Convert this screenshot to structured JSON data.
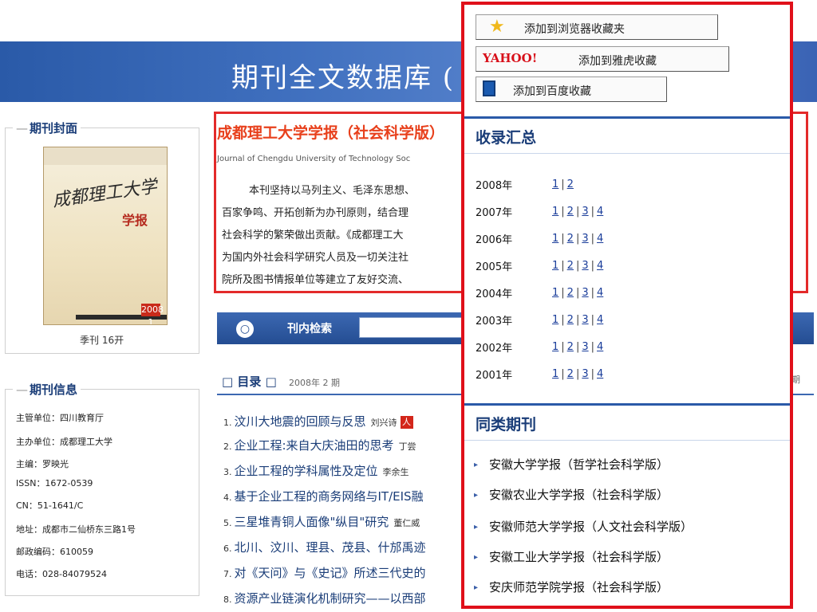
{
  "banner": {
    "title": "期刊全文数据库 ("
  },
  "left": {
    "cover_legend": "期刊封面",
    "cover_art": {
      "calligraphy": "成都理工大学",
      "xuebao": "学报",
      "badge": "2008 1"
    },
    "cover_caption": "季刊 16开",
    "info_legend": "期刊信息",
    "info": [
      "主管单位：四川教育厅",
      "主办单位：成都理工大学",
      "主编：罗映光",
      "ISSN：1672-0539",
      "CN：51-1641/C",
      "地址：成都市二仙桥东三路1号",
      "邮政编码：610059",
      "电话：028-84079524"
    ]
  },
  "journal": {
    "title": "成都理工大学学报（社会科学版）",
    "english": "Journal of Chengdu University of Technology Soc",
    "intro": [
      "本刊坚持以马列主义、毛泽东思想、",
      "百家争鸣、开拓创新为办刊原则，结合理",
      "社会科学的繁荣做出贡献。《成都理工大",
      "为国内外社会科学研究人员及一切关注社",
      "院所及图书情报单位等建立了友好交流、"
    ]
  },
  "search": {
    "label": "刊内检索",
    "icon": "magnifier-icon"
  },
  "toc": {
    "heading": "□ 目录 □",
    "issue": "2008年 2 期",
    "right_fragment": "期",
    "items": [
      {
        "num": "1.",
        "title": "汶川大地震的回顾与反思",
        "author": "刘兴诗",
        "pdf": "人"
      },
      {
        "num": "2.",
        "title": "企业工程:来自大庆油田的思考",
        "author": "丁尝",
        "pdf": ""
      },
      {
        "num": "3.",
        "title": "企业工程的学科属性及定位",
        "author": "李余生",
        "pdf": ""
      },
      {
        "num": "4.",
        "title": "基于企业工程的商务网络与IT/EIS融",
        "author": "",
        "pdf": ""
      },
      {
        "num": "5.",
        "title": "三星堆青铜人面像\"纵目\"研究",
        "author": "董仁威",
        "pdf": ""
      },
      {
        "num": "6.",
        "title": "北川、汶川、理县、茂县、什邡禹迹",
        "author": "",
        "pdf": ""
      },
      {
        "num": "7.",
        "title": "对《天问》与《史记》所述三代史的",
        "author": "",
        "pdf": ""
      },
      {
        "num": "8.",
        "title": "资源产业链演化机制研究——以西部",
        "author": "",
        "pdf": ""
      }
    ]
  },
  "panel": {
    "favorites": [
      {
        "icon": "star-icon",
        "label": "添加到浏览器收藏夹"
      },
      {
        "icon": "yahoo-logo",
        "logo_text": "YAHOO!",
        "label": "添加到雅虎收藏"
      },
      {
        "icon": "book-icon",
        "label": "添加到百度收藏"
      }
    ],
    "summary_title": "收录汇总",
    "years": [
      {
        "year": "2008年",
        "issues": [
          "1",
          "2"
        ]
      },
      {
        "year": "2007年",
        "issues": [
          "1",
          "2",
          "3",
          "4"
        ]
      },
      {
        "year": "2006年",
        "issues": [
          "1",
          "2",
          "3",
          "4"
        ]
      },
      {
        "year": "2005年",
        "issues": [
          "1",
          "2",
          "3",
          "4"
        ]
      },
      {
        "year": "2004年",
        "issues": [
          "1",
          "2",
          "3",
          "4"
        ]
      },
      {
        "year": "2003年",
        "issues": [
          "1",
          "2",
          "3",
          "4"
        ]
      },
      {
        "year": "2002年",
        "issues": [
          "1",
          "2",
          "3",
          "4"
        ]
      },
      {
        "year": "2001年",
        "issues": [
          "1",
          "2",
          "3",
          "4"
        ]
      }
    ],
    "similar_title": "同类期刊",
    "similar": [
      "安徽大学学报（哲学社会科学版）",
      "安徽农业大学学报（社会科学版）",
      "安徽师范大学学报（人文社会科学版）",
      "安徽工业大学学报（社会科学版）",
      "安庆师范学院学报（社会科学版）"
    ]
  },
  "colors": {
    "banner": "#3f6fbe",
    "highlight_border": "#e32a2a",
    "panel_border": "#e0101a",
    "link": "#1a3d9a",
    "title_orange": "#e8401c"
  }
}
